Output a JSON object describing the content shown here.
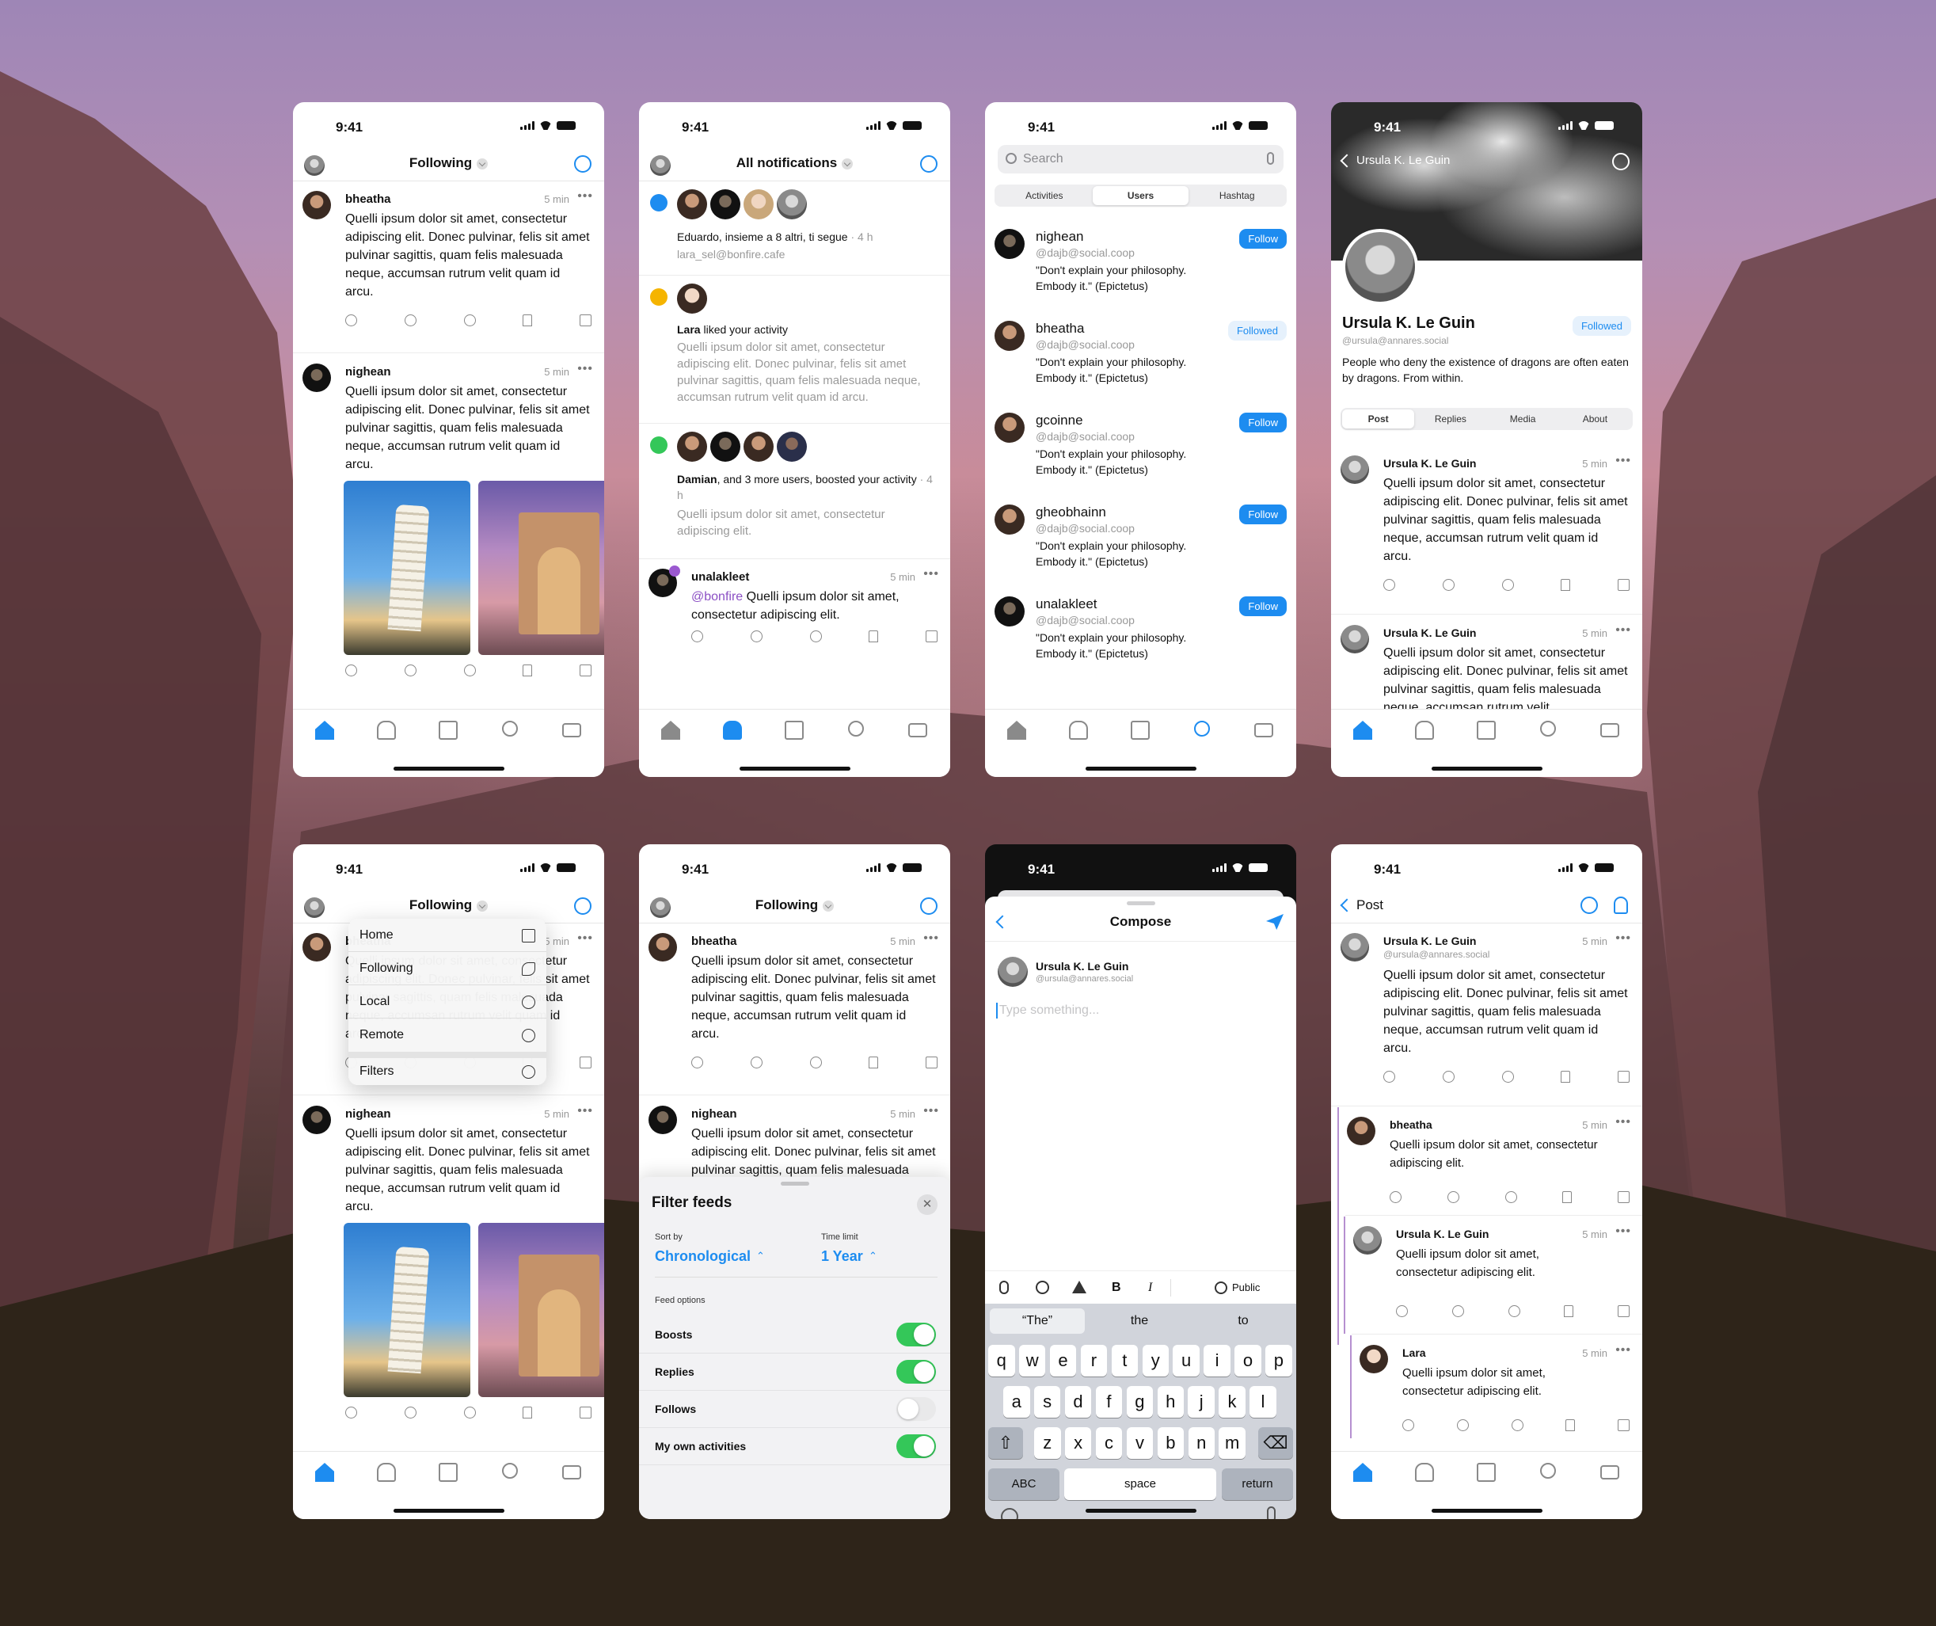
{
  "status_time": "9:41",
  "feed": {
    "title": "Following",
    "posts": [
      {
        "author": "bheatha",
        "time": "5 min",
        "text": "Quelli ipsum dolor sit amet, consectetur adipiscing elit. Donec pulvinar, felis sit amet pulvinar sagittis, quam felis malesuada neque, accumsan rutrum velit quam id arcu."
      },
      {
        "author": "nighean",
        "time": "5 min",
        "text": "Quelli ipsum dolor sit amet, consectetur adipiscing elit. Donec pulvinar, felis sit amet pulvinar sagittis, quam felis malesuada neque, accumsan rutrum velit quam id arcu."
      }
    ]
  },
  "notifications": {
    "title": "All notifications",
    "n1": {
      "text": "Eduardo, insieme a 8 altri, ti segue",
      "time": "· 4 h",
      "sub": "lara_sel@bonfire.cafe"
    },
    "n2": {
      "actor": "Lara",
      "text": " liked your activity",
      "body": "Quelli ipsum dolor sit amet, consectetur adipiscing elit. Donec pulvinar, felis sit amet pulvinar sagittis, quam felis malesuada neque, accumsan rutrum velit quam id arcu."
    },
    "n3": {
      "actor": "Damian",
      "text": ", and 3 more users, boosted your activity",
      "time": " · 4 h",
      "body": "Quelli ipsum dolor sit amet, consectetur adipiscing elit."
    },
    "n4": {
      "author": "unalakleet",
      "time": "5 min",
      "mention": "@bonfire",
      "text": " Quelli ipsum dolor sit amet, consectetur adipiscing elit."
    }
  },
  "search": {
    "placeholder": "Search",
    "tabs": [
      "Activities",
      "Users",
      "Hashtag"
    ],
    "users": [
      {
        "name": "nighean",
        "handle": "@dajb@social.coop",
        "bio": "\"Don't explain your philosophy. Embody it.\" (Epictetus)",
        "action": "Follow"
      },
      {
        "name": "bheatha",
        "handle": "@dajb@social.coop",
        "bio": "\"Don't explain your philosophy. Embody it.\" (Epictetus)",
        "action": "Followed"
      },
      {
        "name": "gcoinne",
        "handle": "@dajb@social.coop",
        "bio": "\"Don't explain your philosophy. Embody it.\" (Epictetus)",
        "action": "Follow"
      },
      {
        "name": "gheobhainn",
        "handle": "@dajb@social.coop",
        "bio": "\"Don't explain your philosophy. Embody it.\" (Epictetus)",
        "action": "Follow"
      },
      {
        "name": "unalakleet",
        "handle": "@dajb@social.coop",
        "bio": "\"Don't explain your philosophy. Embody it.\" (Epictetus)",
        "action": "Follow"
      }
    ]
  },
  "profile": {
    "nav_title": "Ursula K. Le Guin",
    "name": "Ursula K. Le Guin",
    "handle": "@ursula@annares.social",
    "follow_state": "Followed",
    "bio": "People who deny the existence of dragons are often eaten by dragons. From within.",
    "tabs": [
      "Post",
      "Replies",
      "Media",
      "About"
    ],
    "posts": [
      {
        "author": "Ursula K. Le Guin",
        "time": "5 min",
        "text": "Quelli ipsum dolor sit amet, consectetur adipiscing elit. Donec pulvinar, felis sit amet pulvinar sagittis, quam felis malesuada neque, accumsan rutrum velit quam id arcu."
      },
      {
        "author": "Ursula K. Le Guin",
        "time": "5 min",
        "text": "Quelli ipsum dolor sit amet, consectetur adipiscing elit. Donec pulvinar, felis sit amet pulvinar sagittis, quam felis malesuada neque, accumsan rutrum velit"
      }
    ]
  },
  "menu": {
    "items": [
      "Home",
      "Following",
      "Local",
      "Remote"
    ],
    "filters": "Filters"
  },
  "filter": {
    "title": "Filter feeds",
    "sort_label": "Sort by",
    "sort_value": "Chronological",
    "time_label": "Time limit",
    "time_value": "1 Year",
    "options_label": "Feed options",
    "options": [
      {
        "label": "Boosts",
        "on": true
      },
      {
        "label": "Replies",
        "on": true
      },
      {
        "label": "Follows",
        "on": false
      },
      {
        "label": "My own activities",
        "on": true
      }
    ]
  },
  "compose": {
    "title": "Compose",
    "author": "Ursula K. Le Guin",
    "handle": "@ursula@annares.social",
    "placeholder": "Type something...",
    "visibility": "Public",
    "suggestions": [
      "“The”",
      "the",
      "to"
    ],
    "row1": [
      "q",
      "w",
      "e",
      "r",
      "t",
      "y",
      "u",
      "i",
      "o",
      "p"
    ],
    "row2": [
      "a",
      "s",
      "d",
      "f",
      "g",
      "h",
      "j",
      "k",
      "l"
    ],
    "row3": [
      "z",
      "x",
      "c",
      "v",
      "b",
      "n",
      "m"
    ],
    "abc": "ABC",
    "space": "space",
    "ret": "return",
    "fmt_bold": "B",
    "fmt_italic": "I"
  },
  "thread": {
    "title": "Post",
    "main": {
      "author": "Ursula K. Le Guin",
      "handle": "@ursula@annares.social",
      "time": "5 min",
      "text": "Quelli ipsum dolor sit amet, consectetur adipiscing elit. Donec pulvinar, felis sit amet pulvinar sagittis, quam felis malesuada neque, accumsan rutrum velit quam id arcu."
    },
    "replies": [
      {
        "author": "bheatha",
        "time": "5 min",
        "text": "Quelli ipsum dolor sit amet, consectetur adipiscing elit."
      },
      {
        "author": "Ursula K. Le Guin",
        "time": "5 min",
        "text": "Quelli ipsum dolor sit amet, consectetur adipiscing elit."
      },
      {
        "author": "Lara",
        "time": "5 min",
        "text": "Quelli ipsum dolor sit amet, consectetur adipiscing elit."
      }
    ]
  }
}
